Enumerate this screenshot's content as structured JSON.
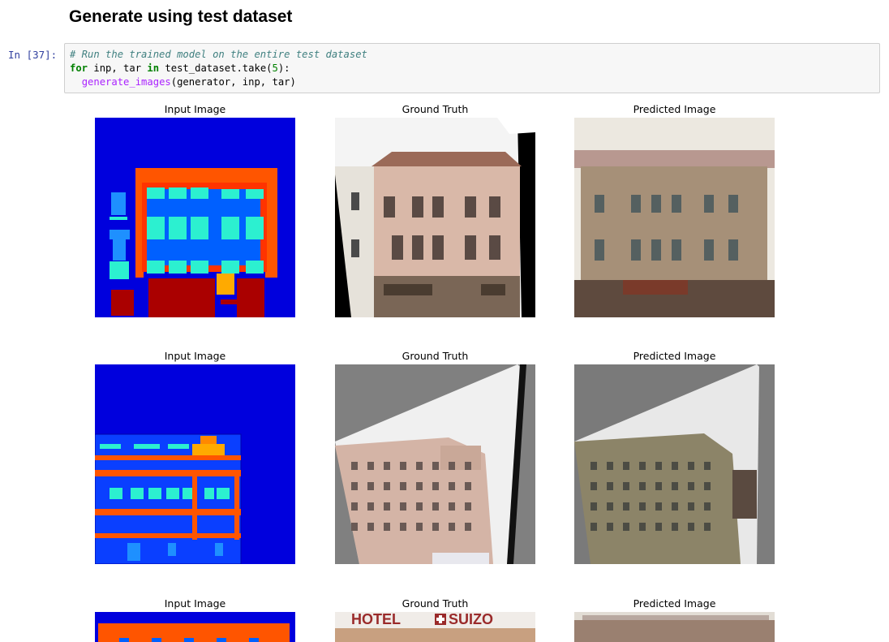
{
  "notebook": {
    "heading": "Generate using test dataset",
    "cell_prompt": "In  [37]:",
    "code": {
      "comment": "# Run the trained model on the entire test dataset",
      "line2": {
        "kw_for": "for",
        "part1": " inp, tar ",
        "kw_in": "in",
        "part2": " test_dataset.take(",
        "num": "5",
        "part3": "):"
      },
      "line3": {
        "fn": "generate_images",
        "args": "(generator, inp, tar)"
      }
    }
  },
  "figures": [
    {
      "titles": [
        "Input Image",
        "Ground Truth",
        "Predicted Image"
      ]
    },
    {
      "titles": [
        "Input Image",
        "Ground Truth",
        "Predicted Image"
      ]
    },
    {
      "titles": [
        "Input Image",
        "Ground Truth",
        "Predicted Image"
      ],
      "sign_text": "HOTEL",
      "sign_text2": "SUIZO"
    }
  ],
  "colors": {
    "label_blue": "#0000dd",
    "label_red": "#aa0000",
    "label_orange": "#ff5500",
    "label_cyan": "#2cf0d0",
    "label_lightblue": "#1e90ff",
    "building_pink": "#d9b8a8",
    "sky": "#f4f4f4",
    "gray_fill": "#808080"
  }
}
